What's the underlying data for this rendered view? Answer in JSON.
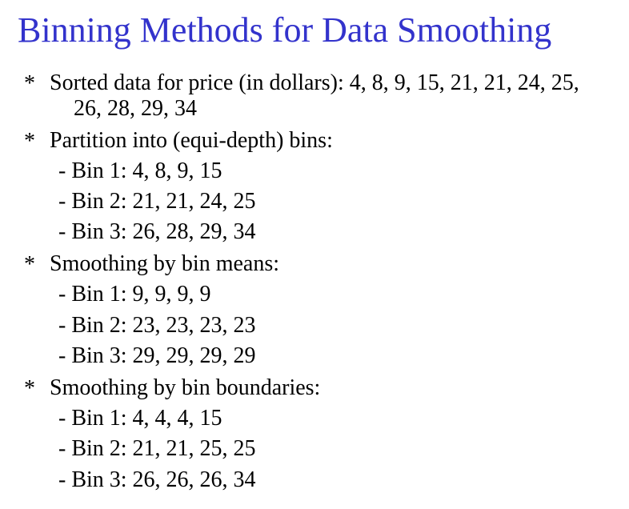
{
  "slide": {
    "title": "Binning Methods for Data Smoothing",
    "title_color": "#3333cc",
    "bullet_marker": "*",
    "sections": [
      {
        "lines": [
          "Sorted data for price (in dollars): 4, 8, 9, 15, 21, 21, 24, 25,",
          "26, 28, 29, 34"
        ],
        "items": []
      },
      {
        "lines": [
          "Partition into (equi-depth) bins:"
        ],
        "items": [
          "- Bin 1: 4, 8, 9, 15",
          "- Bin 2: 21, 21, 24, 25",
          "- Bin 3: 26, 28, 29, 34"
        ]
      },
      {
        "lines": [
          "Smoothing by bin means:"
        ],
        "items": [
          "- Bin 1: 9, 9, 9, 9",
          "- Bin 2: 23, 23, 23, 23",
          "- Bin 3: 29, 29, 29, 29"
        ]
      },
      {
        "lines": [
          "Smoothing by bin boundaries:"
        ],
        "items": [
          "- Bin 1: 4, 4, 4, 15",
          "- Bin 2: 21, 21, 25, 25",
          "- Bin 3: 26, 26, 26, 34"
        ]
      }
    ]
  }
}
